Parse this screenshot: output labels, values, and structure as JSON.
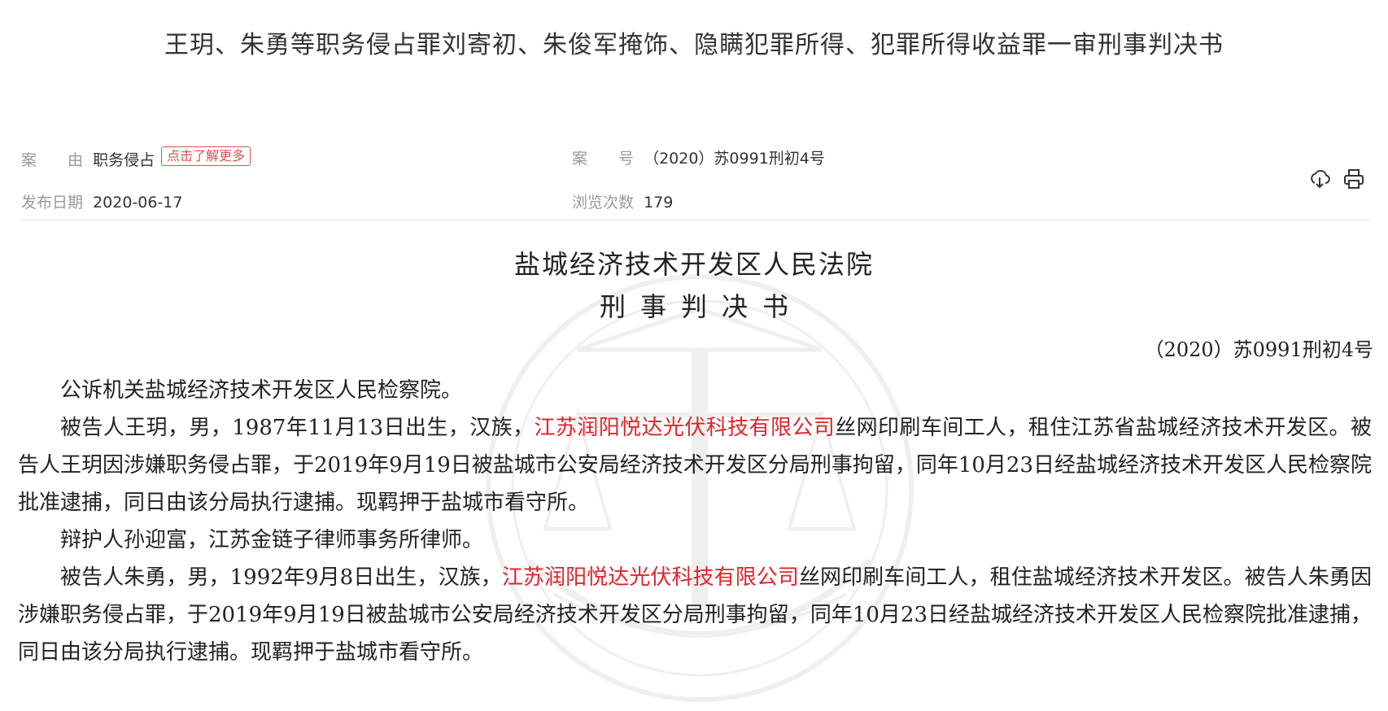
{
  "title": "王玥、朱勇等职务侵占罪刘寄初、朱俊军掩饰、隐瞒犯罪所得、犯罪所得收益罪一审刑事判决书",
  "meta": {
    "cause_label": "案　　由",
    "cause_value": "职务侵占",
    "learn_more": "点击了解更多",
    "case_no_label": "案　　号",
    "case_no_value": "（2020）苏0991刑初4号",
    "publish_label": "发布日期",
    "publish_value": "2020-06-17",
    "views_label": "浏览次数",
    "views_value": "179"
  },
  "icons": {
    "download": "download-icon",
    "print": "print-icon"
  },
  "document": {
    "court": "盐城经济技术开发区人民法院",
    "type": "刑事判决书",
    "number": "（2020）苏0991刑初4号",
    "company": "江苏润阳悦达光伏科技有限公司",
    "p1": "公诉机关盐城经济技术开发区人民检察院。",
    "p2_a": "被告人王玥，男，1987年11月13日出生，汉族，",
    "p2_b": "丝网印刷车间工人，租住江苏省盐城经济技术开发区。被告人王玥因涉嫌职务侵占罪，于2019年9月19日被盐城市公安局经济技术开发区分局刑事拘留，同年10月23日经盐城经济技术开发区人民检察院批准逮捕，同日由该分局执行逮捕。现羁押于盐城市看守所。",
    "p3": "辩护人孙迎富，江苏金链子律师事务所律师。",
    "p4_a": "被告人朱勇，男，1992年9月8日出生，汉族，",
    "p4_b": "丝网印刷车间工人，租住盐城经济技术开发区。被告人朱勇因涉嫌职务侵占罪，于2019年9月19日被盐城市公安局经济技术开发区分局刑事拘留，同年10月23日经盐城经济技术开发区人民检察院批准逮捕，同日由该分局执行逮捕。现羁押于盐城市看守所。"
  },
  "colors": {
    "accent_red": "#e0242a",
    "label_gray": "#999999",
    "text": "#222222"
  }
}
